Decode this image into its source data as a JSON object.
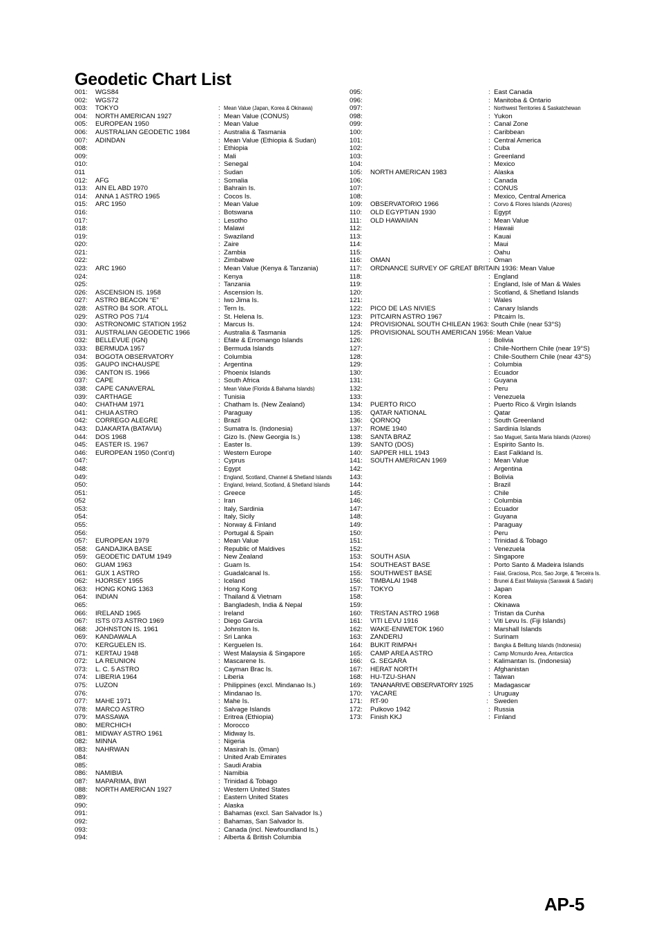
{
  "document": {
    "title": "Geodetic Chart List",
    "page_label": "AP-5"
  },
  "columns": {
    "left": [
      {
        "num": "001:",
        "name": "WGS84",
        "desc": ""
      },
      {
        "num": "002:",
        "name": "WGS72",
        "desc": ""
      },
      {
        "num": "003:",
        "name": "TOKYO",
        "desc": "Mean Value (Japan, Korea & Okinawa)",
        "cond": true
      },
      {
        "num": "004:",
        "name": "NORTH AMERICAN 1927",
        "desc": "Mean Value (CONUS)"
      },
      {
        "num": "005:",
        "name": "EUROPEAN 1950",
        "desc": "Mean Value"
      },
      {
        "num": "006:",
        "name": "AUSTRALIAN GEODETIC 1984",
        "desc": "Australia & Tasmania"
      },
      {
        "num": "007:",
        "name": "ADINDAN",
        "desc": "Mean Value (Ethiopia & Sudan)"
      },
      {
        "num": "008:",
        "name": "",
        "desc": "Ethiopia"
      },
      {
        "num": "009:",
        "name": "",
        "desc": "Mali"
      },
      {
        "num": "010:",
        "name": "",
        "desc": "Senegal"
      },
      {
        "num": "011",
        "name": "",
        "desc": "Sudan"
      },
      {
        "num": "012:",
        "name": "AFG",
        "desc": "Somalia"
      },
      {
        "num": "013:",
        "name": "AIN EL ABD 1970",
        "desc": "Bahrain Is."
      },
      {
        "num": "014:",
        "name": "ANNA 1 ASTRO 1965",
        "desc": "Cocos Is."
      },
      {
        "num": "015:",
        "name": "ARC 1950",
        "desc": "Mean Value"
      },
      {
        "num": "016:",
        "name": "",
        "desc": "Botswana"
      },
      {
        "num": "017:",
        "name": "",
        "desc": "Lesotho"
      },
      {
        "num": "018:",
        "name": "",
        "desc": "Malawi"
      },
      {
        "num": "019:",
        "name": "",
        "desc": "Swaziland"
      },
      {
        "num": "020:",
        "name": "",
        "desc": "Zaire"
      },
      {
        "num": "021:",
        "name": "",
        "desc": "Zambia"
      },
      {
        "num": "022:",
        "name": "",
        "desc": "Zimbabwe"
      },
      {
        "num": "023:",
        "name": "ARC 1960",
        "desc": "Mean Value (Kenya & Tanzania)"
      },
      {
        "num": "024:",
        "name": "",
        "desc": "Kenya"
      },
      {
        "num": "025:",
        "name": "",
        "desc": "Tanzania"
      },
      {
        "num": "026:",
        "name": "ASCENSION IS. 1958",
        "desc": "Ascension Is."
      },
      {
        "num": "027:",
        "name": "ASTRO BEACON “E”",
        "desc": "Iwo Jima Is."
      },
      {
        "num": "028:",
        "name": "ASTRO B4 SOR. ATOLL",
        "desc": "Tern Is."
      },
      {
        "num": "029:",
        "name": "ASTRO POS 71/4",
        "desc": "St. Helena Is."
      },
      {
        "num": "030:",
        "name": "ASTRONOMIC STATION 1952",
        "desc": "Marcus Is."
      },
      {
        "num": "031:",
        "name": "AUSTRALIAN GEODETIC 1966",
        "desc": "Australia & Tasmania"
      },
      {
        "num": "032:",
        "name": "BELLEVUE (IGN)",
        "desc": "Efate & Erromango Islands"
      },
      {
        "num": "033:",
        "name": "BERMUDA 1957",
        "desc": "Bermuda Islands"
      },
      {
        "num": "034:",
        "name": "BOGOTA OBSERVATORY",
        "desc": "Columbia"
      },
      {
        "num": "035:",
        "name": "GAUPO INCHAUSPE",
        "desc": "Argentina"
      },
      {
        "num": "036:",
        "name": "CANTON IS. 1966",
        "desc": "Phoenix Islands"
      },
      {
        "num": "037:",
        "name": "CAPE",
        "desc": "South Africa"
      },
      {
        "num": "038:",
        "name": "CAPE CANAVERAL",
        "desc": "Mean Value (Florida & Bahama Islands)",
        "cond": true
      },
      {
        "num": "039:",
        "name": "CARTHAGE",
        "desc": "Tunisia"
      },
      {
        "num": "040:",
        "name": "CHATHAM 1971",
        "desc": "Chatham Is. (New Zealand)"
      },
      {
        "num": "041:",
        "name": "CHUA ASTRO",
        "desc": "Paraguay"
      },
      {
        "num": "042:",
        "name": "CORREGO ALEGRE",
        "desc": "Brazil"
      },
      {
        "num": "043:",
        "name": "DJAKARTA (BATAVIA)",
        "desc": "Sumatra Is. (Indonesia)"
      },
      {
        "num": "044:",
        "name": "DOS 1968",
        "desc": "Gizo Is. (New Georgia Is.)"
      },
      {
        "num": "045:",
        "name": "EASTER IS. 1967",
        "desc": "Easter Is."
      },
      {
        "num": "046:",
        "name": "EUROPEAN 1950 (Cont’d)",
        "desc": "Western Europe"
      },
      {
        "num": "047:",
        "name": "",
        "desc": "Cyprus"
      },
      {
        "num": "048:",
        "name": "",
        "desc": "Egypt"
      },
      {
        "num": "049:",
        "name": "",
        "desc": "England, Scotland, Channel & Shetland Islands",
        "cond": true
      },
      {
        "num": "050:",
        "name": "",
        "desc": "England, Ireland, Scotland, &   Shetland Islands",
        "cond": true
      },
      {
        "num": "051:",
        "name": "",
        "desc": "Greece"
      },
      {
        "num": "052",
        "name": "",
        "desc": "Iran"
      },
      {
        "num": "053:",
        "name": "",
        "desc": "Italy, Sardinia"
      },
      {
        "num": "054:",
        "name": "",
        "desc": "Italy, Sicily"
      },
      {
        "num": "055:",
        "name": "",
        "desc": "Norway & Finland"
      },
      {
        "num": "056:",
        "name": "",
        "desc": "Portugal & Spain"
      },
      {
        "num": "057:",
        "name": "EUROPEAN 1979",
        "desc": "Mean Value"
      },
      {
        "num": "058:",
        "name": "GANDAJIKA BASE",
        "desc": "Republic of Maldives"
      },
      {
        "num": "059:",
        "name": "GEODETIC DATUM 1949",
        "desc": "New Zealand"
      },
      {
        "num": "060:",
        "name": "GUAM 1963",
        "desc": "Guam Is."
      },
      {
        "num": "061:",
        "name": "GUX 1 ASTRO",
        "desc": "Guadalcanal Is."
      },
      {
        "num": "062:",
        "name": "HJORSEY 1955",
        "desc": "Iceland"
      },
      {
        "num": "063:",
        "name": "HONG KONG 1363",
        "desc": "Hong Kong"
      },
      {
        "num": "064:",
        "name": "INDIAN",
        "desc": "Thailand & Vietnam"
      },
      {
        "num": "065:",
        "name": "",
        "desc": "Bangladesh, India & Nepal"
      },
      {
        "num": "066:",
        "name": "IRELAND 1965",
        "desc": "Ireland"
      },
      {
        "num": "067:",
        "name": "ISTS 073 ASTRO 1969",
        "desc": "Diego Garcia"
      },
      {
        "num": "068:",
        "name": "JOHNSTON IS. 1961",
        "desc": "Johnston Is."
      },
      {
        "num": "069:",
        "name": "KANDAWALA",
        "desc": "Sri Lanka"
      },
      {
        "num": "070:",
        "name": "KERGUELEN IS.",
        "desc": "Kerguelen Is."
      },
      {
        "num": "071:",
        "name": "KERTAU 1948",
        "desc": "West Malaysia & Singapore"
      },
      {
        "num": "072:",
        "name": "LA REUNION",
        "desc": "Mascarene Is."
      },
      {
        "num": "073:",
        "name": "L. C. 5 ASTRO",
        "desc": "Cayman Brac Is."
      },
      {
        "num": "074:",
        "name": "LIBERIA 1964",
        "desc": "Liberia"
      },
      {
        "num": "075:",
        "name": "LUZON",
        "desc": "Philippines (excl. Mindanao Is.)"
      },
      {
        "num": "076:",
        "name": "",
        "desc": "Mindanao Is."
      },
      {
        "num": "077:",
        "name": "MAHE 1971",
        "desc": "Mahe Is."
      },
      {
        "num": "078:",
        "name": "MARCO ASTRO",
        "desc": "Salvage Islands"
      },
      {
        "num": "079:",
        "name": "MASSAWA",
        "desc": "Eritrea (Ethiopia)"
      },
      {
        "num": "080:",
        "name": "MERCHICH",
        "desc": "Morocco"
      },
      {
        "num": "081:",
        "name": "MIDWAY ASTRO 1961",
        "desc": "Midway Is."
      },
      {
        "num": "082:",
        "name": "MINNA",
        "desc": "Nigeria"
      },
      {
        "num": "083:",
        "name": "NAHRWAN",
        "desc": "Masirah Is. (0man)"
      },
      {
        "num": "084:",
        "name": "",
        "desc": "United Arab Emirates"
      },
      {
        "num": "085:",
        "name": "",
        "desc": "Saudi Arabia"
      },
      {
        "num": "086:",
        "name": "NAMIBIA",
        "desc": "Namibia"
      },
      {
        "num": "087:",
        "name": "MAPARIMA, BWI",
        "desc": "Trinidad & Tobago"
      },
      {
        "num": "088:",
        "name": "NORTH AMERICAN 1927",
        "desc": "Western United States"
      },
      {
        "num": "089:",
        "name": "",
        "desc": "Eastern United States"
      },
      {
        "num": "090:",
        "name": "",
        "desc": "Alaska"
      },
      {
        "num": "091:",
        "name": "",
        "desc": "Bahamas (excl. San Salvador Is.)"
      },
      {
        "num": "092:",
        "name": "",
        "desc": "Bahamas, San Salvador Is."
      },
      {
        "num": "093:",
        "name": "",
        "desc": "Canada (incl. Newfoundland Is.)"
      },
      {
        "num": "094:",
        "name": "",
        "desc": "Alberta & British Columbia"
      }
    ],
    "right": [
      {
        "num": "095:",
        "name": "",
        "desc": "East Canada"
      },
      {
        "num": "096:",
        "name": "",
        "desc": "Manitoba & Ontario"
      },
      {
        "num": "097:",
        "name": "",
        "desc": "Northwest Territories & Saskatchewan",
        "cond": true
      },
      {
        "num": "098:",
        "name": "",
        "desc": "Yukon"
      },
      {
        "num": "099:",
        "name": "",
        "desc": "Canal Zone"
      },
      {
        "num": "100:",
        "name": "",
        "desc": "Caribbean"
      },
      {
        "num": "101:",
        "name": "",
        "desc": "Central America"
      },
      {
        "num": "102:",
        "name": "",
        "desc": "Cuba"
      },
      {
        "num": "103:",
        "name": "",
        "desc": "Greenland"
      },
      {
        "num": "104:",
        "name": "",
        "desc": "Mexico"
      },
      {
        "num": "105:",
        "name": "NORTH AMERICAN 1983",
        "desc": "Alaska"
      },
      {
        "num": "106:",
        "name": "",
        "desc": "Canada"
      },
      {
        "num": "107:",
        "name": "",
        "desc": "CONUS"
      },
      {
        "num": "108:",
        "name": "",
        "desc": "Mexico, Central America"
      },
      {
        "num": "109:",
        "name": "OBSERVATORIO 1966",
        "desc": "Corvo & Flores Islands (Azores)",
        "cond2": true
      },
      {
        "num": "110:",
        "name": "OLD EGYPTIAN 1930",
        "desc": "Egypt"
      },
      {
        "num": "111:",
        "name": "OLD HAWAIIAN",
        "desc": "Mean Value"
      },
      {
        "num": "112:",
        "name": "",
        "desc": "Hawaii"
      },
      {
        "num": "113:",
        "name": "",
        "desc": "Kauai"
      },
      {
        "num": "114:",
        "name": "",
        "desc": "Maui"
      },
      {
        "num": "115:",
        "name": "",
        "desc": "Oahu"
      },
      {
        "num": "116:",
        "name": "OMAN",
        "desc": "Oman"
      },
      {
        "num": "117:",
        "name": "ORDNANCE SURVEY OF GREAT BRITAIN 1936: Mean Value",
        "desc": "",
        "wide": true
      },
      {
        "num": "118:",
        "name": "",
        "desc": "England"
      },
      {
        "num": "119:",
        "name": "",
        "desc": "England, Isle of Man & Wales"
      },
      {
        "num": "120:",
        "name": "",
        "desc": "Scotland, & Shetland Islands"
      },
      {
        "num": "121:",
        "name": "",
        "desc": "Wales"
      },
      {
        "num": "122:",
        "name": "PICO DE LAS NIVIES",
        "desc": "Canary Islands"
      },
      {
        "num": "123:",
        "name": "PITCAIRN ASTRO 1967",
        "desc": "Pitcairn Is."
      },
      {
        "num": "124:",
        "name": "PROVISIONAL SOUTH CHILEAN 1963: South Chile (near 53°S)",
        "desc": "",
        "wide": true
      },
      {
        "num": "125:",
        "name": "PROVISIONAL SOUTH AMERICAN 1956: Mean Value",
        "desc": "",
        "wide": true
      },
      {
        "num": "126:",
        "name": "",
        "desc": "Bolivia"
      },
      {
        "num": "127:",
        "name": "",
        "desc": "Chile-Northern Chile (near 19°S)"
      },
      {
        "num": "128:",
        "name": "",
        "desc": "Chile-Southern Chile (near 43°S)"
      },
      {
        "num": "129:",
        "name": "",
        "desc": "Columbia"
      },
      {
        "num": "130:",
        "name": "",
        "desc": "Ecuador"
      },
      {
        "num": "131:",
        "name": "",
        "desc": "Guyana"
      },
      {
        "num": "132:",
        "name": "",
        "desc": "Peru"
      },
      {
        "num": "133:",
        "name": "",
        "desc": "Venezuela"
      },
      {
        "num": "134:",
        "name": "PUERTO RICO",
        "desc": "Puerto Rico & Virgin Islands"
      },
      {
        "num": "135:",
        "name": "QATAR NATIONAL",
        "desc": "Qatar"
      },
      {
        "num": "136:",
        "name": "QORNOQ",
        "desc": "South Greenland"
      },
      {
        "num": "137:",
        "name": "ROME 1940",
        "desc": "Sardinia Islands"
      },
      {
        "num": "138:",
        "name": "SANTA BRAZ",
        "desc": "Sao Maguel, Santa Maria Islands (Azores)",
        "cond": true
      },
      {
        "num": "139:",
        "name": "SANTO (DOS)",
        "desc": "Espirito Santo Is."
      },
      {
        "num": "140:",
        "name": "SAPPER HILL 1943",
        "desc": "East Falkland Is."
      },
      {
        "num": "141:",
        "name": "SOUTH AMERICAN 1969",
        "desc": "Mean Value"
      },
      {
        "num": "142:",
        "name": "",
        "desc": "Argentina"
      },
      {
        "num": "143:",
        "name": "",
        "desc": "Bolivia"
      },
      {
        "num": "144:",
        "name": "",
        "desc": "Brazil"
      },
      {
        "num": "145:",
        "name": "",
        "desc": "Chile"
      },
      {
        "num": "146:",
        "name": "",
        "desc": "Columbia"
      },
      {
        "num": "147:",
        "name": "",
        "desc": "Ecuador"
      },
      {
        "num": "148:",
        "name": "",
        "desc": "Guyana"
      },
      {
        "num": "149:",
        "name": "",
        "desc": "Paraguay"
      },
      {
        "num": "150:",
        "name": "",
        "desc": "Peru"
      },
      {
        "num": "151:",
        "name": "",
        "desc": "Trinidad & Tobago"
      },
      {
        "num": "152:",
        "name": "",
        "desc": "Venezuela"
      },
      {
        "num": "153:",
        "name": "SOUTH ASIA",
        "desc": "Singapore"
      },
      {
        "num": "154:",
        "name": "SOUTHEAST BASE",
        "desc": "Porto Santo & Madeira Islands"
      },
      {
        "num": "155:",
        "name": "SOUTHWEST BASE",
        "desc": "Faial, Graciosa, Pico, Sao Jorge, & Terceira Is.",
        "cond": true
      },
      {
        "num": "156:",
        "name": "TIMBALAI 1948",
        "desc": "Brunei & East Malaysia (Sarawak & Sadah)",
        "cond": true
      },
      {
        "num": "157:",
        "name": "TOKYO",
        "desc": "Japan"
      },
      {
        "num": "158:",
        "name": "",
        "desc": "Korea"
      },
      {
        "num": "159:",
        "name": "",
        "desc": "Okinawa"
      },
      {
        "num": "160:",
        "name": "TRISTAN ASTRO 1968",
        "desc": "Tristan da Cunha"
      },
      {
        "num": "161:",
        "name": "VITI LEVU 1916",
        "desc": "Viti Levu Is. (Fiji Islands)"
      },
      {
        "num": "162:",
        "name": "WAKE-ENIWETOK 1960",
        "desc": "Marshall Islands"
      },
      {
        "num": "163:",
        "name": "ZANDERIJ",
        "desc": "Surinam"
      },
      {
        "num": "164:",
        "name": "BUKIT RIMPAH",
        "desc": "Bangka & Belitung Islands (Indonesia)",
        "cond": true
      },
      {
        "num": "165:",
        "name": "CAMP AREA ASTRO",
        "desc": "Camp Mcmurdo Area, Antarctica",
        "cond2": true
      },
      {
        "num": "166:",
        "name": "G. SEGARA",
        "desc": "Kalimantan Is. (Indonesia)"
      },
      {
        "num": "167:",
        "name": "HERAT NORTH",
        "desc": "Afghanistan"
      },
      {
        "num": "168:",
        "name": "HU-TZU-SHAN",
        "desc": "Taiwan"
      },
      {
        "num": "169:",
        "name": "TANANARIVE OBSERVATORY 1925",
        "desc": "Madagascar",
        "tight": true
      },
      {
        "num": "170:",
        "name": "YACARE",
        "desc": "Uruguay"
      },
      {
        "num": "171:",
        "name": "RT-90",
        "desc": "Sweden",
        "sepshift": -3
      },
      {
        "num": "172:",
        "name": "Pulkovo 1942",
        "desc": "Russia"
      },
      {
        "num": "173:",
        "name": "Finish KKJ",
        "desc": "Finland"
      }
    ]
  },
  "separator": ":"
}
